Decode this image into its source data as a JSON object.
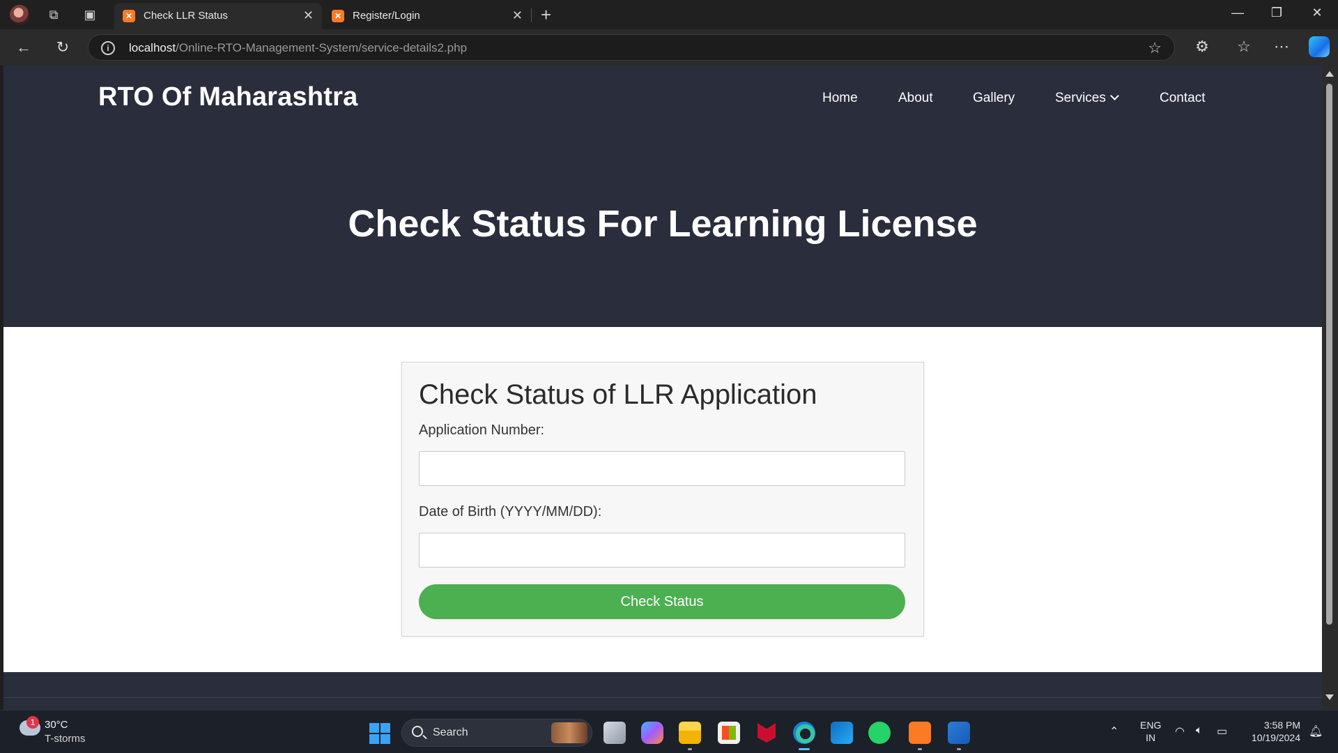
{
  "browser": {
    "tabs": [
      {
        "title": "Check LLR Status",
        "active": true
      },
      {
        "title": "Register/Login",
        "active": false
      }
    ],
    "url_host": "localhost",
    "url_path": "/Online-RTO-Management-System/service-details2.php"
  },
  "site": {
    "brand": "RTO Of Maharashtra",
    "nav": {
      "home": "Home",
      "about": "About",
      "gallery": "Gallery",
      "services": "Services",
      "contact": "Contact"
    },
    "hero_title": "Check Status For Learning License"
  },
  "form": {
    "title": "Check Status of LLR Application",
    "app_number_label": "Application Number:",
    "app_number_value": "",
    "dob_label": "Date of Birth (YYYY/MM/DD):",
    "dob_value": "",
    "submit_label": "Check Status"
  },
  "taskbar": {
    "weather_temp": "30°C",
    "weather_condition": "T-storms",
    "weather_badge": "1",
    "search_label": "Search",
    "lang_line1": "ENG",
    "lang_line2": "IN",
    "time": "3:58 PM",
    "date": "10/19/2024"
  },
  "colors": {
    "hero_bg": "#2a2d3c",
    "button_green": "#4caf50",
    "xampp_orange": "#fb7a24"
  }
}
